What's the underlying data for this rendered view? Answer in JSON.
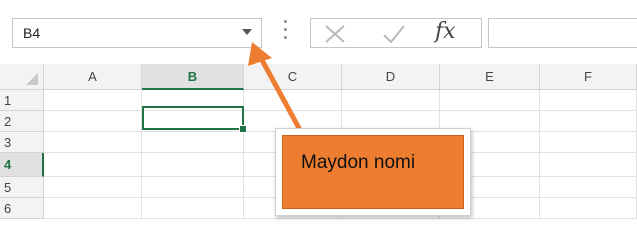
{
  "name_box": {
    "value": "B4"
  },
  "formula_bar": {
    "cancel_icon": "cancel-x-icon",
    "enter_icon": "checkmark-icon",
    "function_label": "fx",
    "value": ""
  },
  "columns": [
    "A",
    "B",
    "C",
    "D",
    "E",
    "F"
  ],
  "rows": [
    "1",
    "2",
    "3",
    "4",
    "5",
    "6"
  ],
  "selected": {
    "column": "B",
    "row": "4"
  },
  "callout": {
    "label": "Maydon nomi"
  },
  "colors": {
    "selection_green": "#217346",
    "callout_fill": "#ed7d31",
    "arrow": "#ed7d31"
  }
}
